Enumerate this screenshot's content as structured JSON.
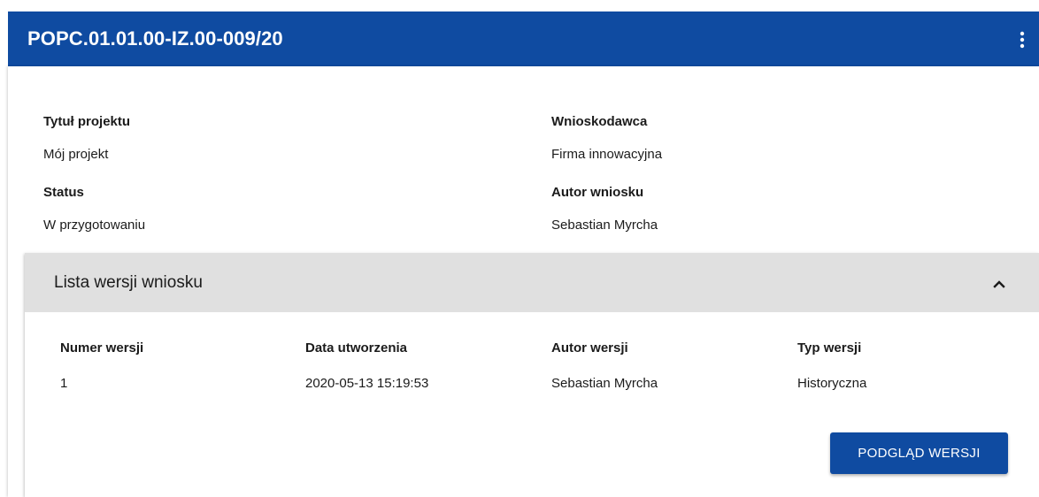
{
  "header": {
    "title": "POPC.01.01.00-IZ.00-009/20",
    "menu_icon": "more-vertical-icon"
  },
  "project": {
    "title_label": "Tytuł projektu",
    "title_value": "Mój projekt",
    "applicant_label": "Wnioskodawca",
    "applicant_value": "Firma innowacyjna",
    "status_label": "Status",
    "status_value": "W przygotowaniu",
    "author_label": "Autor wniosku",
    "author_value": "Sebastian Myrcha"
  },
  "versions": {
    "section_title": "Lista wersji wniosku",
    "toggle_icon": "chevron-up-icon",
    "columns": [
      "Numer wersji",
      "Data utworzenia",
      "Autor wersji",
      "Typ wersji"
    ],
    "rows": [
      [
        "1",
        "2020-05-13 15:19:53",
        "Sebastian Myrcha",
        "Historyczna"
      ]
    ],
    "preview_button": "PODGLĄD WERSJI"
  },
  "colors": {
    "primary": "#0f4ba1",
    "section_header_bg": "#e0e0e0",
    "text": "#1b1b1b"
  }
}
